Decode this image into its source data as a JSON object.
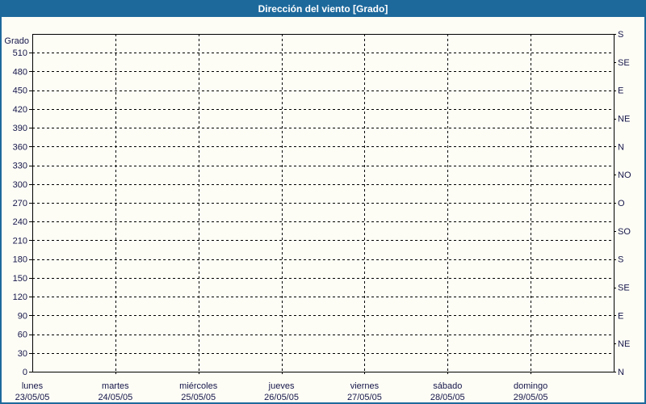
{
  "window": {
    "title": "Dirección del viento [Grado]"
  },
  "colors": {
    "titlebar_bg": "#1d699c",
    "titlebar_text": "#ffffff",
    "frame_border": "#1d699c",
    "content_bg": "#fdfdf6",
    "grid": "#000000",
    "axis": "#000000",
    "label_text": "#15154a"
  },
  "chart_data": {
    "type": "line",
    "title": "Dirección del viento [Grado]",
    "grid": "dashed",
    "series": [],
    "y_axis": {
      "label": "Grado",
      "min": 0,
      "max": 540,
      "tick_step": 30,
      "tick_values": [
        510,
        480,
        450,
        420,
        390,
        360,
        330,
        300,
        270,
        240,
        210,
        180,
        150,
        120,
        90,
        60,
        30,
        0
      ]
    },
    "right_axis": {
      "tick_step_degrees": 45,
      "labels_top_to_bottom": [
        "S",
        "SE",
        "E",
        "NE",
        "N",
        "NO",
        "O",
        "SO",
        "S",
        "SE",
        "E",
        "NE",
        "N"
      ],
      "degrees_top_to_bottom": [
        540,
        495,
        450,
        405,
        360,
        315,
        270,
        225,
        180,
        135,
        90,
        45,
        0
      ]
    },
    "x_axis": {
      "categories": [
        {
          "day": "lunes",
          "date": "23/05/05"
        },
        {
          "day": "martes",
          "date": "24/05/05"
        },
        {
          "day": "miércoles",
          "date": "25/05/05"
        },
        {
          "day": "jueves",
          "date": "26/05/05"
        },
        {
          "day": "viernes",
          "date": "27/05/05"
        },
        {
          "day": "sábado",
          "date": "28/05/05"
        },
        {
          "day": "domingo",
          "date": "29/05/05"
        }
      ]
    }
  }
}
